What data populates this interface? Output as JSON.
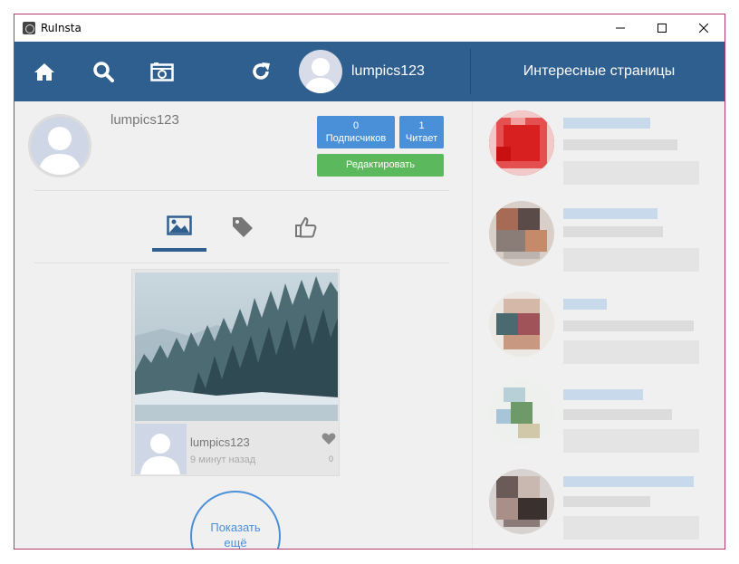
{
  "window": {
    "title": "RuInsta"
  },
  "toolbar": {
    "icons": [
      "home-icon",
      "search-icon",
      "camera-icon",
      "refresh-icon"
    ],
    "username": "lumpics123",
    "right_title": "Интересные страницы"
  },
  "profile": {
    "name": "lumpics123",
    "followers_count": "0",
    "followers_label": "Подписчиков",
    "following_count": "1",
    "following_label": "Читает",
    "edit_label": "Редактировать"
  },
  "tabs": [
    {
      "icon": "image-icon",
      "active": true
    },
    {
      "icon": "tag-icon",
      "active": false
    },
    {
      "icon": "thumbs-up-icon",
      "active": false
    }
  ],
  "post": {
    "username": "lumpics123",
    "time": "9 минут назад",
    "likes": "0"
  },
  "show_more": {
    "line1": "Показать",
    "line2": "ещё"
  },
  "colors": {
    "toolbar": "#2f5f8e",
    "stat_button": "#4a90d9",
    "edit_button": "#5cb85c",
    "window_border": "#b23a6c"
  }
}
